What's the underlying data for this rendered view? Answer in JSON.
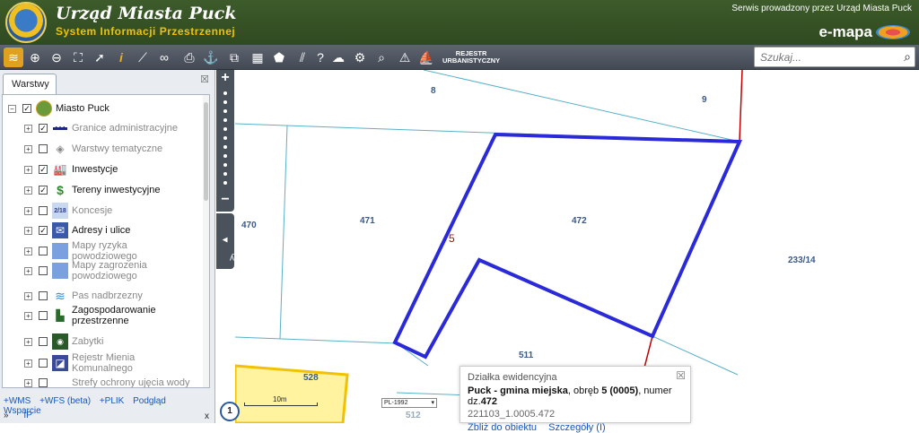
{
  "header": {
    "title": "Urząd Miasta Puck",
    "subtitle": "System Informacji Przestrzennej",
    "service_text": "Serwis prowadzony przez Urząd Miasta Puck",
    "brand": "e-mapa"
  },
  "toolbar": {
    "rejestr_line1": "REJESTR",
    "rejestr_line2": "URBANISTYCZNY",
    "search_placeholder": "Szukaj..."
  },
  "panel": {
    "tab_label": "Warstwy",
    "root_label": "Miasto Puck",
    "layers": [
      {
        "label": "Granice administracyjne",
        "checked": true,
        "active": false
      },
      {
        "label": "Warstwy tematyczne",
        "checked": false,
        "active": false
      },
      {
        "label": "Inwestycje",
        "checked": true,
        "active": true
      },
      {
        "label": "Tereny inwestycyjne",
        "checked": true,
        "active": true
      },
      {
        "label": "Koncesje",
        "checked": false,
        "active": false,
        "icon_text": "2/18"
      },
      {
        "label": "Adresy i ulice",
        "checked": true,
        "active": true
      },
      {
        "label": "Mapy ryzyka powodziowego",
        "checked": false,
        "active": false
      },
      {
        "label": "Mapy zagrozenia powodziowego",
        "checked": false,
        "active": false
      },
      {
        "label": "Pas nadbrzezny",
        "checked": false,
        "active": false
      },
      {
        "label": "Zagospodarowanie przestrzenne",
        "checked": false,
        "active": true
      },
      {
        "label": "Zabytki",
        "checked": false,
        "active": false
      },
      {
        "label": "Rejestr Mienia Komunalnego",
        "checked": false,
        "active": false
      },
      {
        "label": "Strefy ochrony ujęcia wody",
        "checked": false,
        "active": false
      }
    ],
    "links": [
      "+WMS",
      "+WFS (beta)",
      "+PLIK",
      "Podgląd",
      "Wsparcie"
    ],
    "links2": [
      "»",
      "IP"
    ],
    "close_x": "x"
  },
  "side_tab": "Warstwy",
  "map": {
    "parcels": [
      "8",
      "9",
      "470",
      "471",
      "472",
      "233/14",
      "511",
      "528",
      "512",
      "a"
    ],
    "red_label": "5",
    "scale_label": "10m",
    "crs": "PL-1992",
    "circle_label": "1"
  },
  "popup": {
    "title": "Działka ewidencyjna",
    "main_bold1": "Puck - gmina miejska",
    "main_text1": ", obręb ",
    "main_bold2": "5 (0005)",
    "main_text2": ", numer dz.",
    "main_bold3": "472",
    "id": "221103_1.0005.472",
    "link1": "Zbliż do obiektu",
    "link2": "Szczegóły (I)"
  }
}
